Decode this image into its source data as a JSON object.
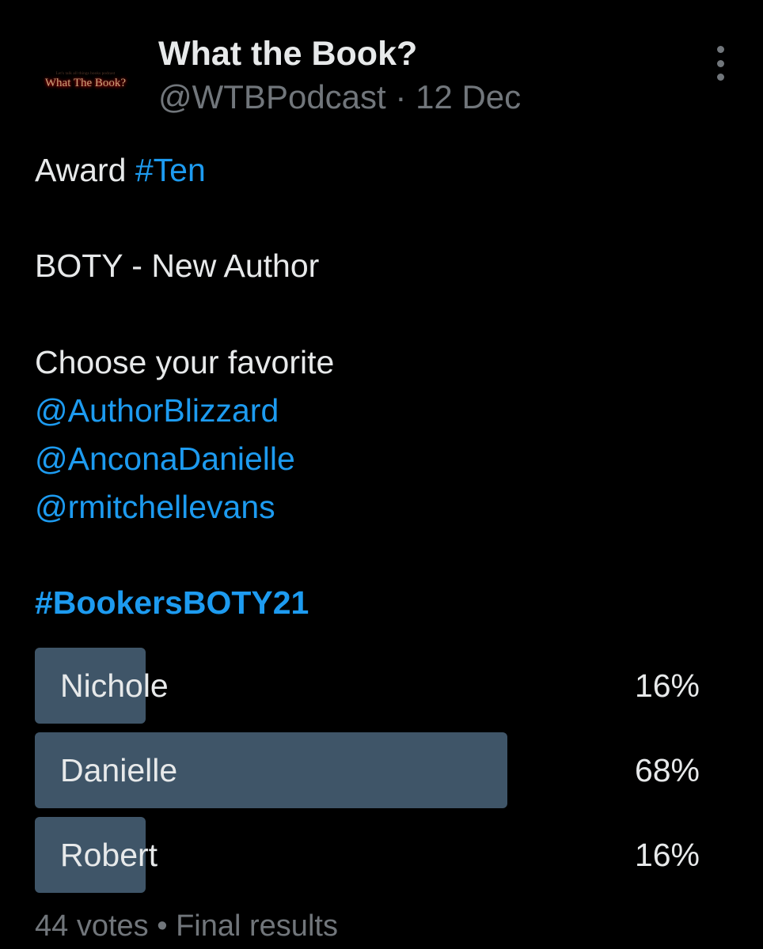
{
  "author": {
    "display_name": "What the Book?",
    "handle": "@WTBPodcast",
    "separator": "·",
    "date": "12 Dec",
    "avatar": {
      "logo_text": "What The Book?",
      "tagline": "Let's talk all things books podcast"
    }
  },
  "tweet": {
    "line1_prefix": "Award ",
    "line1_hashtag": "#Ten",
    "line2": "BOTY - New Author",
    "line3": "Choose your favorite",
    "mentions": [
      "@AuthorBlizzard",
      "@AnconaDanielle",
      "@rmitchellevans"
    ],
    "hashtag": "#BookersBOTY21"
  },
  "poll": {
    "options": [
      {
        "label": "Nichole",
        "percent_text": "16%",
        "percent": 16
      },
      {
        "label": "Danielle",
        "percent_text": "68%",
        "percent": 68
      },
      {
        "label": "Robert",
        "percent_text": "16%",
        "percent": 16
      }
    ],
    "votes": "44 votes",
    "dot": "•",
    "status": "Final results"
  },
  "colors": {
    "background": "#000000",
    "text": "#e7e9ea",
    "secondary_text": "#71767b",
    "link": "#1d9bf0",
    "poll_bar": "#3f5568"
  },
  "icons": {
    "more": "more-vertical-icon"
  }
}
